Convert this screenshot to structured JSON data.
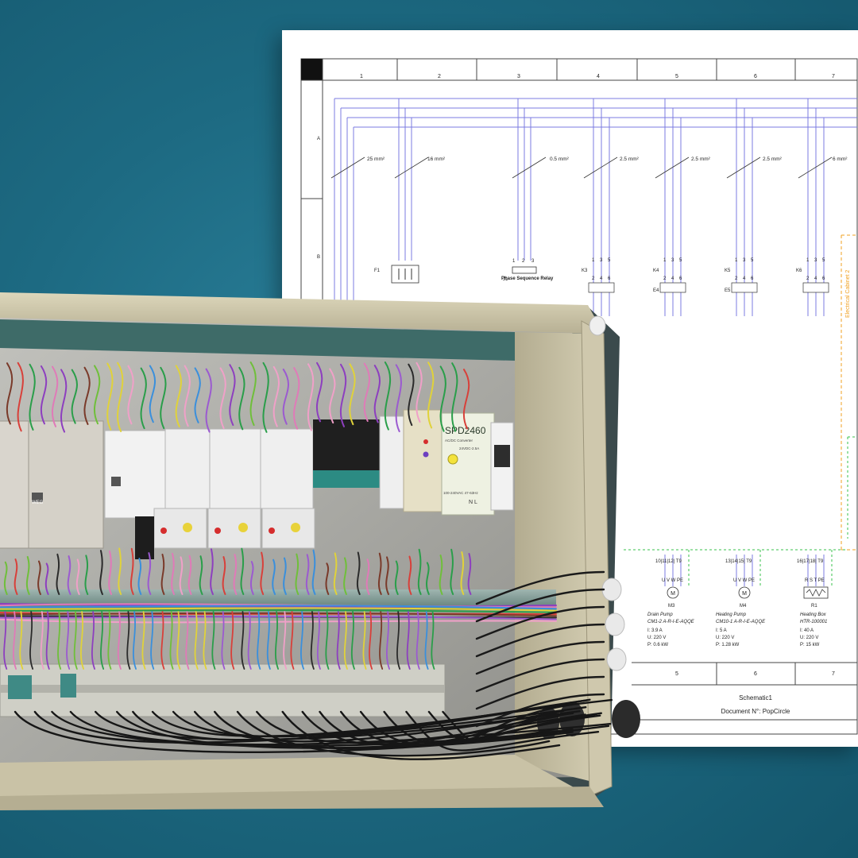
{
  "schematic": {
    "column_numbers": [
      "1",
      "2",
      "3",
      "4",
      "5",
      "6",
      "7"
    ],
    "row_letters": [
      "A",
      "B"
    ],
    "bottom_column_numbers": [
      "5",
      "6",
      "7"
    ],
    "wire_sizes": [
      "25 mm²",
      "16 mm²",
      "0.5 mm²",
      "2.5 mm²",
      "2.5 mm²",
      "2.5 mm²",
      "6 mm²"
    ],
    "phase_relay_label": "Phase Sequence Relay",
    "phase_relay_pins": [
      "1",
      "2",
      "3"
    ],
    "cabinet_label": "Electrical Cabinet 2",
    "device_tags": {
      "f1": "F1",
      "j1": "J1",
      "k3": "K3",
      "k4": "K4",
      "k5": "K5",
      "k6": "K6",
      "e4": "E4",
      "e5": "E5"
    },
    "contact_numbers_top": [
      "1",
      "3",
      "5"
    ],
    "contact_numbers_bottom": [
      "2",
      "4",
      "6"
    ],
    "loads": [
      {
        "tag": "M3",
        "terminals": "10|11|12| T9",
        "pins": "U  V  W  PE",
        "name": "Drain Pump",
        "model": "CM1-2 A-R-I-E-AQQE",
        "current": "I: 3.9 A",
        "voltage": "U: 220 V",
        "power": "P: 0.6 kW"
      },
      {
        "tag": "M4",
        "terminals": "13|14|15| T9",
        "pins": "U  V  W  PE",
        "name": "Heating Pump",
        "model": "CM10-1 A-R-I-E-AQQE",
        "current": "I: 5 A",
        "voltage": "U: 220 V",
        "power": "P: 1.28 kW"
      },
      {
        "tag": "R1",
        "terminals": "16|17|18| T9",
        "pins": "R  S  T  PE",
        "name": "Heating Box",
        "model": "HTR-100001",
        "current": "I: 40 A",
        "voltage": "U: 220 V",
        "power": "P: 15 kW"
      }
    ],
    "title_block": {
      "name": "Schematic1",
      "document": "Document N°: PopCircle"
    }
  },
  "cabinet": {
    "power_supply_model": "SPD2460",
    "power_supply_sub": "AC/DC Converter",
    "power_supply_rating": "24VDC-2.5A",
    "power_supply_input": "100-240VAC 47-63Hz",
    "power_supply_terminals": "N  L",
    "brand_mark": "WEG"
  },
  "colors": {
    "background": "#1d6a82",
    "schematic_wire": "#7b7be0",
    "pe_wire": "#37c24b",
    "cabinet_outline": "#f0a020",
    "enclosure": "#cfc8a6",
    "backplate": "#a9a9a4"
  }
}
